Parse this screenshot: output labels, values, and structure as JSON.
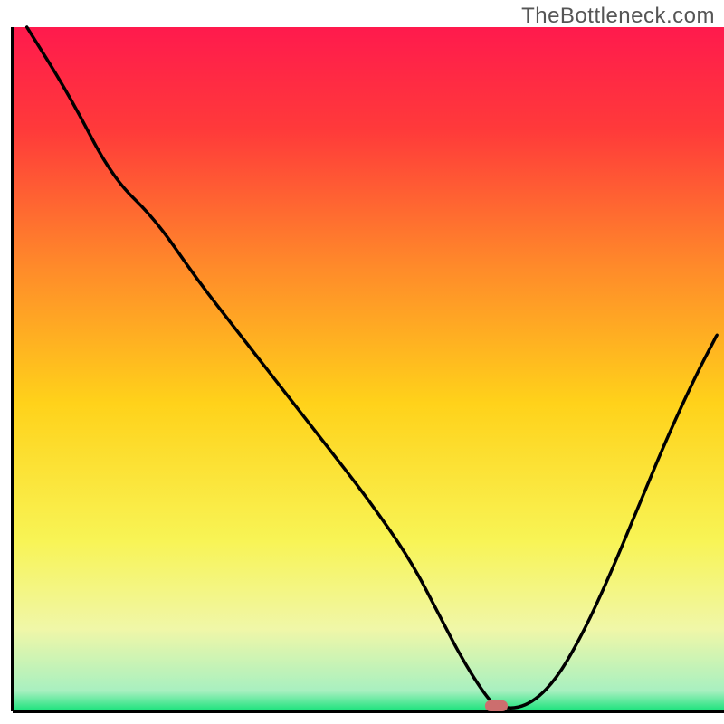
{
  "watermark": "TheBottleneck.com",
  "chart_data": {
    "type": "line",
    "title": "",
    "xlabel": "",
    "ylabel": "",
    "xlim": [
      0,
      100
    ],
    "ylim": [
      0,
      100
    ],
    "grid": false,
    "background_gradient": {
      "stops": [
        {
          "offset": 0.0,
          "color": "#ff1a4d"
        },
        {
          "offset": 0.15,
          "color": "#ff3a3a"
        },
        {
          "offset": 0.35,
          "color": "#ff8a2a"
        },
        {
          "offset": 0.55,
          "color": "#ffd21a"
        },
        {
          "offset": 0.75,
          "color": "#f8f455"
        },
        {
          "offset": 0.88,
          "color": "#f0f7a8"
        },
        {
          "offset": 0.97,
          "color": "#a8f0c0"
        },
        {
          "offset": 1.0,
          "color": "#16e27a"
        }
      ]
    },
    "series": [
      {
        "name": "bottleneck-curve",
        "color": "#000000",
        "x": [
          2,
          8,
          14,
          20,
          26,
          32,
          38,
          44,
          50,
          56,
          60,
          63,
          66,
          68,
          72,
          76,
          80,
          84,
          88,
          92,
          96,
          99
        ],
        "y": [
          100,
          90,
          78,
          72,
          63,
          55,
          47,
          39,
          31,
          22,
          14,
          8,
          3,
          0.5,
          0.5,
          4,
          11,
          20,
          30,
          40,
          49,
          55
        ]
      }
    ],
    "marker": {
      "name": "optimal-point",
      "x": 68,
      "y": 0.8,
      "color": "#cc6e6e",
      "shape": "rounded-rect",
      "width": 3.2,
      "height": 1.6
    }
  },
  "icons": {}
}
